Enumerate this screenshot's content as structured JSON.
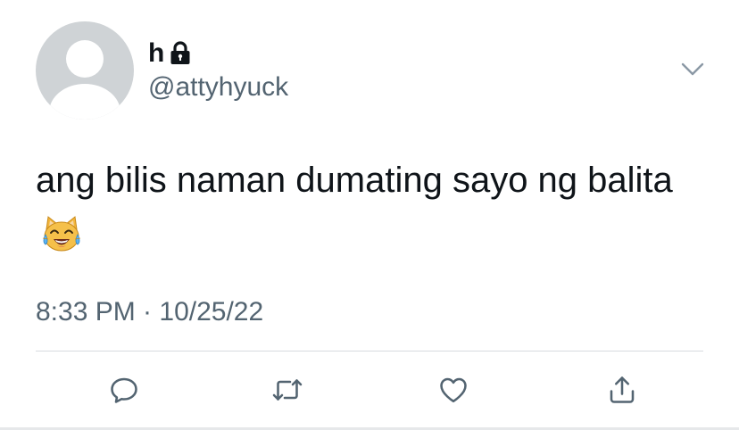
{
  "author": {
    "display_name": "h",
    "username": "@attyhyuck",
    "protected_icon": "lock-icon",
    "avatar": "default-avatar"
  },
  "tweet": {
    "text": "ang bilis naman dumating sayo ng balita",
    "emoji": "cat-face-with-tears-of-joy",
    "timestamp": "8:33 PM · 10/25/22"
  },
  "actions": [
    "reply-icon",
    "retweet-icon",
    "like-icon",
    "share-icon"
  ],
  "colors": {
    "text": "#0f1419",
    "secondary_text": "#536471",
    "icon": "#536471",
    "avatar_bg": "#cfd3d6",
    "divider": "#d7dbdf"
  }
}
